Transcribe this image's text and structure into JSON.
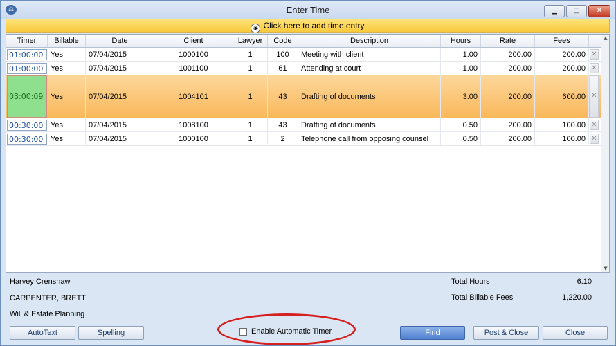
{
  "window": {
    "title": "Enter Time",
    "minimize": "▁",
    "maximize": "□",
    "close": "✕",
    "icon": "scales-icon"
  },
  "add_bar": {
    "label": "Click here to add time entry",
    "icon": "add-entry-icon"
  },
  "columns": [
    "Timer",
    "Billable",
    "Date",
    "Client",
    "Lawyer",
    "Code",
    "Description",
    "Hours",
    "Rate",
    "Fees"
  ],
  "rows": [
    {
      "timer": "01:00:00",
      "billable": "Yes",
      "date": "07/04/2015",
      "client": "1000100",
      "lawyer": "1",
      "code": "100",
      "description": "Meeting with client",
      "hours": "1.00",
      "rate": "200.00",
      "fees": "200.00",
      "selected": false
    },
    {
      "timer": "01:00:00",
      "billable": "Yes",
      "date": "07/04/2015",
      "client": "1001100",
      "lawyer": "1",
      "code": "61",
      "description": "Attending at court",
      "hours": "1.00",
      "rate": "200.00",
      "fees": "200.00",
      "selected": false
    },
    {
      "timer": "03:00:09",
      "billable": "Yes",
      "date": "07/04/2015",
      "client": "1004101",
      "lawyer": "1",
      "code": "43",
      "description": "Drafting of documents",
      "hours": "3.00",
      "rate": "200.00",
      "fees": "600.00",
      "selected": true
    },
    {
      "timer": "00:30:00",
      "billable": "Yes",
      "date": "07/04/2015",
      "client": "1008100",
      "lawyer": "1",
      "code": "43",
      "description": "Drafting of documents",
      "hours": "0.50",
      "rate": "200.00",
      "fees": "100.00",
      "selected": false
    },
    {
      "timer": "00:30:00",
      "billable": "Yes",
      "date": "07/04/2015",
      "client": "1000100",
      "lawyer": "1",
      "code": "2",
      "description": "Telephone call from opposing counsel",
      "hours": "0.50",
      "rate": "200.00",
      "fees": "100.00",
      "selected": false
    }
  ],
  "footer": {
    "lawyer_name": "Harvey Crenshaw",
    "client_name": "CARPENTER, BRETT",
    "matter": "Will & Estate Planning",
    "total_hours_label": "Total Hours",
    "total_hours": "6.10",
    "total_fees_label": "Total Billable Fees",
    "total_fees": "1,220.00"
  },
  "buttons": {
    "autotext": "AutoText",
    "spelling": "Spelling",
    "enable_timer": "Enable Automatic Timer",
    "find": "Find",
    "post_close": "Post & Close",
    "close": "Close"
  },
  "colors": {
    "selected_row": "#f9b85a",
    "timer_active": "#8ee08e",
    "annotation": "#d61f1f"
  }
}
